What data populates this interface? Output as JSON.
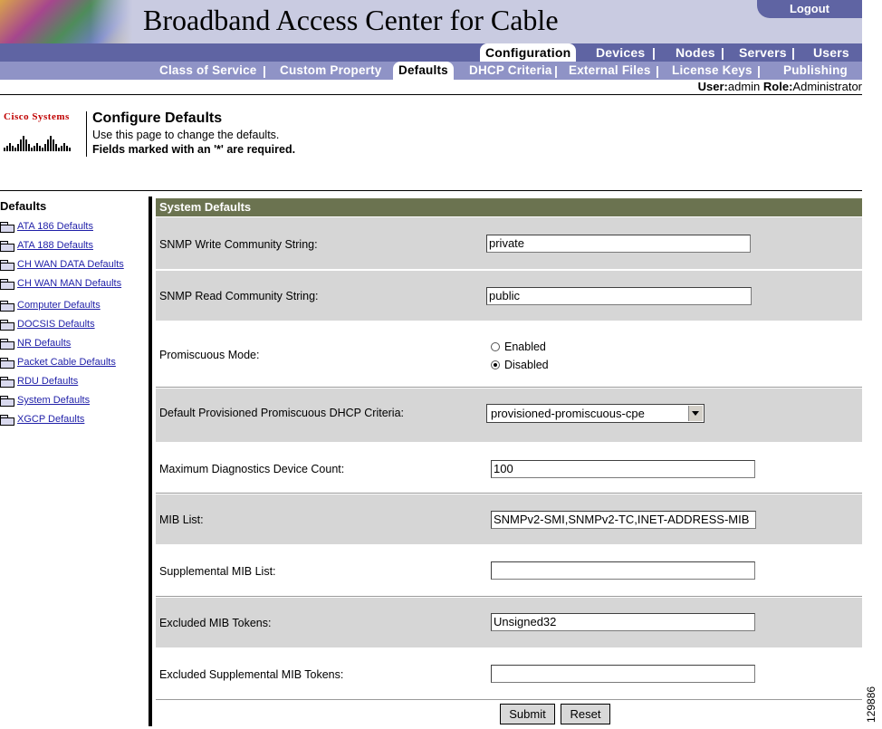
{
  "header": {
    "title": "Broadband Access Center for Cable",
    "logout": "Logout"
  },
  "nav_primary": [
    {
      "label": "Configuration",
      "active": true
    },
    {
      "label": "Devices"
    },
    {
      "label": "Nodes"
    },
    {
      "label": "Servers"
    },
    {
      "label": "Users"
    }
  ],
  "nav_secondary": [
    {
      "label": "Class of Service"
    },
    {
      "label": "Custom Property"
    },
    {
      "label": "Defaults",
      "active": true
    },
    {
      "label": "DHCP Criteria"
    },
    {
      "label": "External Files"
    },
    {
      "label": "License Keys"
    },
    {
      "label": "Publishing"
    }
  ],
  "separator": "|",
  "userline": {
    "user_label": "User:",
    "user_value": "admin",
    "role_label": "Role:",
    "role_value": "Administrator"
  },
  "brand": {
    "company": "Cisco Systems"
  },
  "page": {
    "title": "Configure Defaults",
    "subtitle": "Use this page to change the defaults.",
    "required_note": "Fields marked with an '*' are required."
  },
  "tree": {
    "title": "Defaults",
    "items": [
      "ATA 186 Defaults",
      "ATA 188 Defaults",
      "CH WAN DATA Defaults",
      "CH WAN MAN Defaults",
      "Computer Defaults",
      "DOCSIS Defaults",
      "NR Defaults",
      "Packet Cable Defaults",
      "RDU Defaults",
      "System Defaults",
      "XGCP Defaults"
    ]
  },
  "form": {
    "section_title": "System Defaults",
    "fields": {
      "snmp_write": {
        "label": "SNMP Write Community String:",
        "value": "private"
      },
      "snmp_read": {
        "label": "SNMP Read Community String:",
        "value": "public"
      },
      "promiscuous": {
        "label": "Promiscuous Mode:",
        "options": [
          "Enabled",
          "Disabled"
        ],
        "selected": "Disabled"
      },
      "dhcp_criteria": {
        "label": "Default Provisioned Promiscuous DHCP Criteria:",
        "value": "provisioned-promiscuous-cpe"
      },
      "max_diag": {
        "label": "Maximum Diagnostics Device Count:",
        "value": "100"
      },
      "mib_list": {
        "label": "MIB List:",
        "value": "SNMPv2-SMI,SNMPv2-TC,INET-ADDRESS-MIB"
      },
      "supp_mib": {
        "label": "Supplemental MIB List:",
        "value": ""
      },
      "excl_mib": {
        "label": "Excluded MIB Tokens:",
        "value": "Unsigned32"
      },
      "excl_supp_mib": {
        "label": "Excluded Supplemental MIB Tokens:",
        "value": ""
      }
    },
    "submit_label": "Submit",
    "reset_label": "Reset"
  },
  "figure_number": "129886"
}
